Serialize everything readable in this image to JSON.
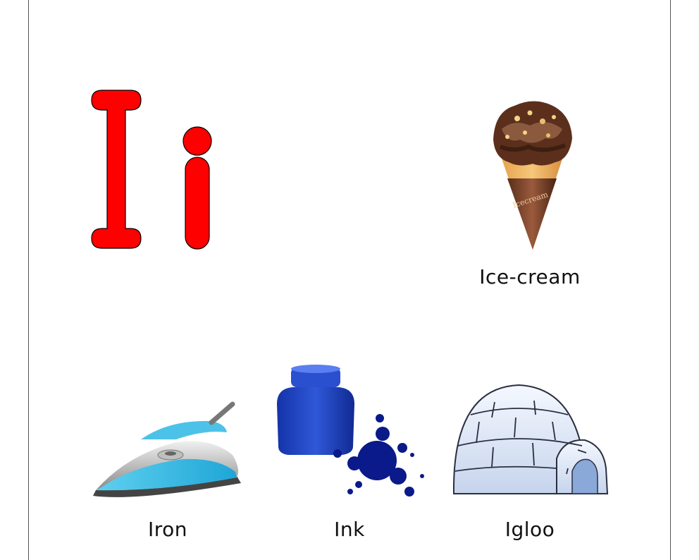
{
  "page": {
    "letter_upper": "I",
    "letter_lower": "i",
    "letter_color": "#ff0000"
  },
  "items": [
    {
      "label": "Ice-cream",
      "icon": "ice-cream-icon"
    },
    {
      "label": "Iron",
      "icon": "iron-icon"
    },
    {
      "label": "Ink",
      "icon": "ink-icon"
    },
    {
      "label": "Igloo",
      "icon": "igloo-icon"
    }
  ],
  "ice_cream_wrapper_text": "Icecream"
}
